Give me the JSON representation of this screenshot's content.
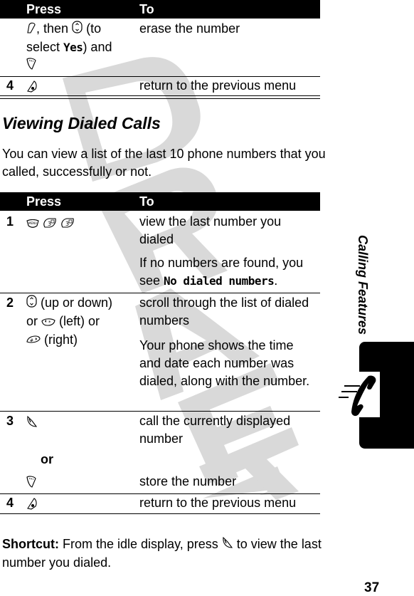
{
  "table1": {
    "header": {
      "press": "Press",
      "to": "To"
    },
    "rows": [
      {
        "number": "",
        "press_parts": [
          "clear-key-icon",
          ", then ",
          "nav-key-icon",
          " (to select ",
          "Yes",
          ") and ",
          "store-key-icon"
        ],
        "press_line1": ", then",
        "press_line1b": "(to",
        "press_line2a": "select ",
        "press_display": "Yes",
        "press_line2b": ") and",
        "to": "erase the number"
      },
      {
        "number": "4",
        "press_icon": "end-key-icon",
        "to": "return to the previous menu"
      }
    ]
  },
  "section": {
    "title": "Viewing Dialed Calls",
    "intro": "You can view a list of the last 10 phone numbers that you called, successfully or not."
  },
  "table2": {
    "header": {
      "press": "Press",
      "to": "To"
    },
    "rows": [
      {
        "number": "1",
        "press_icons": [
          "menu-key-icon",
          "3-key-icon",
          "3-key-icon"
        ],
        "to": "view the last number you dialed",
        "note_prefix": "If no numbers are found, you see ",
        "note_display": "No dialed numbers",
        "note_suffix": "."
      },
      {
        "number": "2",
        "press_a": " (up or down)",
        "press_b": "or ",
        "press_c": " (left) or",
        "press_d": " (right)",
        "to": "scroll through the list of dialed numbers",
        "note": "Your phone shows the time and date each number was dialed, along with the number."
      },
      {
        "number": "3",
        "press_icon": "send-key-icon",
        "to": "call the currently displayed number",
        "or_label": "or",
        "alt_press_icon": "store-key-icon",
        "alt_to": "store the number"
      },
      {
        "number": "4",
        "press_icon": "end-key-icon",
        "to": "return to the previous menu"
      }
    ]
  },
  "shortcut": {
    "label": "Shortcut:",
    "text_before": " From the idle display, press ",
    "text_after": " to view the last number you dialed."
  },
  "side_tab": {
    "label": "Calling Features",
    "icon": "phone-icon"
  },
  "watermark": "DRAFT",
  "page_number": "37"
}
